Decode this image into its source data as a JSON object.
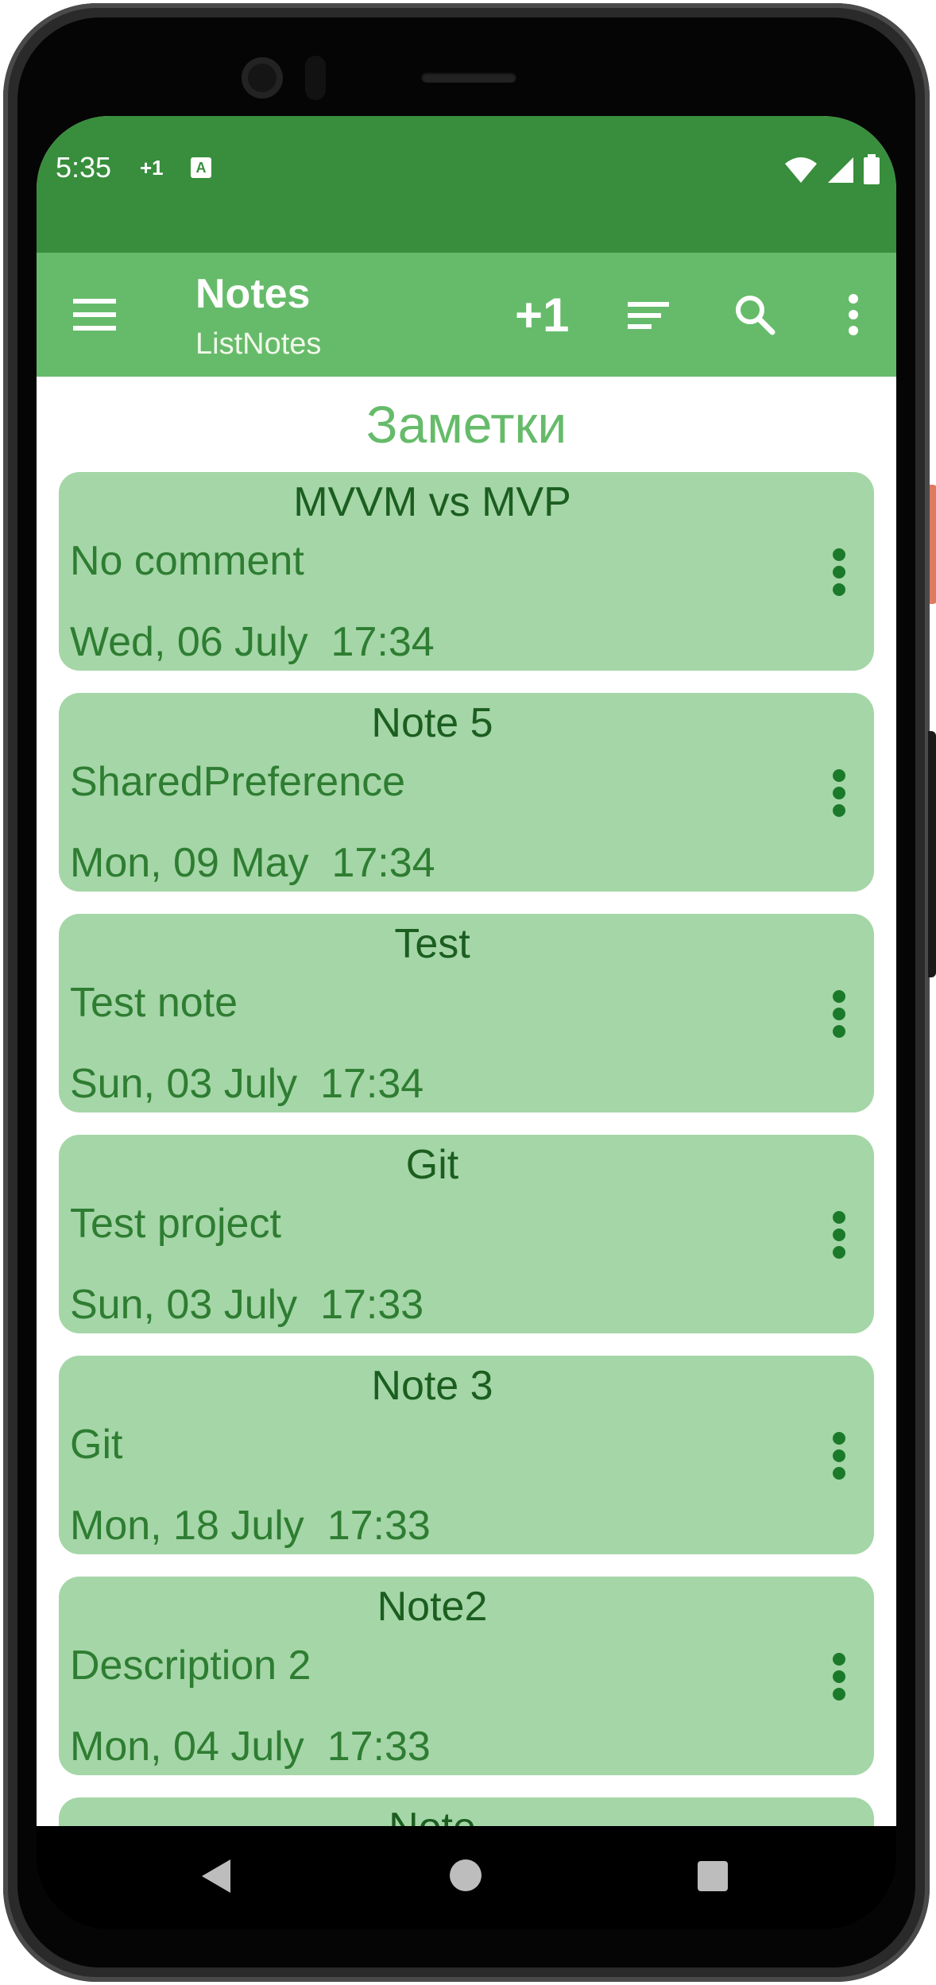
{
  "status_bar": {
    "time": "5:35",
    "notification_count": "+1",
    "keyboard_badge": "A"
  },
  "toolbar": {
    "title": "Notes",
    "subtitle": "ListNotes",
    "add_label": "+1"
  },
  "content": {
    "heading": "Заметки"
  },
  "notes": [
    {
      "title": "MVVM vs MVP",
      "description": "No comment",
      "date": "Wed, 06 July  17:34"
    },
    {
      "title": "Note 5",
      "description": "SharedPreference",
      "date": "Mon, 09 May  17:34"
    },
    {
      "title": "Test",
      "description": "Test note",
      "date": "Sun, 03 July  17:34"
    },
    {
      "title": "Git",
      "description": "Test project",
      "date": "Sun, 03 July  17:33"
    },
    {
      "title": "Note 3",
      "description": "Git",
      "date": "Mon, 18 July  17:33"
    },
    {
      "title": "Note2",
      "description": "Description 2",
      "date": "Mon, 04 July  17:33"
    },
    {
      "title": "Note",
      "description": "",
      "date": ""
    }
  ],
  "colors": {
    "status_bar": "#388e3c",
    "toolbar": "#66bb6a",
    "card": "#a5d6a7",
    "text_dark_green": "#2e7d32"
  },
  "icons": [
    "menu-icon",
    "sort-icon",
    "search-icon",
    "overflow-menu-icon",
    "wifi-icon",
    "signal-icon",
    "battery-icon",
    "back-icon",
    "home-icon",
    "recents-icon"
  ]
}
